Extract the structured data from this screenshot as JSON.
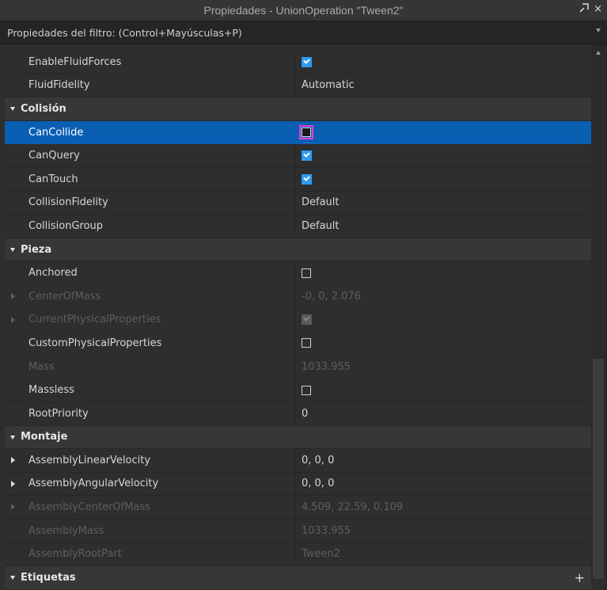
{
  "window": {
    "title": "Propiedades - UnionOperation \"Tween2\"",
    "popout_icon": "popout-icon",
    "close_label": "×"
  },
  "filter": {
    "placeholder": "Propiedades del filtro: (Control+Mayúsculas+P)"
  },
  "rows": [
    {
      "type": "prop",
      "name": "EnableFluidForces",
      "value_type": "checkbox",
      "checked": true
    },
    {
      "type": "prop",
      "name": "FluidFidelity",
      "value_type": "text",
      "value": "Automatic"
    },
    {
      "type": "category",
      "name": "Colisión"
    },
    {
      "type": "prop",
      "name": "CanCollide",
      "value_type": "checkbox",
      "checked": false,
      "selected": true,
      "highlighted": true
    },
    {
      "type": "prop",
      "name": "CanQuery",
      "value_type": "checkbox",
      "checked": true
    },
    {
      "type": "prop",
      "name": "CanTouch",
      "value_type": "checkbox",
      "checked": true
    },
    {
      "type": "prop",
      "name": "CollisionFidelity",
      "value_type": "text",
      "value": "Default"
    },
    {
      "type": "prop",
      "name": "CollisionGroup",
      "value_type": "text",
      "value": "Default"
    },
    {
      "type": "category",
      "name": "Pieza"
    },
    {
      "type": "prop",
      "name": "Anchored",
      "value_type": "checkbox",
      "checked": false
    },
    {
      "type": "prop",
      "name": "CenterOfMass",
      "value_type": "text",
      "value": "-0, 0, 2.076",
      "expandable": true,
      "dim": true
    },
    {
      "type": "prop",
      "name": "CurrentPhysicalProperties",
      "value_type": "checkbox",
      "checked": true,
      "expandable": true,
      "dim": true
    },
    {
      "type": "prop",
      "name": "CustomPhysicalProperties",
      "value_type": "checkbox",
      "checked": false
    },
    {
      "type": "prop",
      "name": "Mass",
      "value_type": "text",
      "value": "1033.955",
      "dim": true
    },
    {
      "type": "prop",
      "name": "Massless",
      "value_type": "checkbox",
      "checked": false
    },
    {
      "type": "prop",
      "name": "RootPriority",
      "value_type": "text",
      "value": "0"
    },
    {
      "type": "category",
      "name": "Montaje"
    },
    {
      "type": "prop",
      "name": "AssemblyLinearVelocity",
      "value_type": "text",
      "value": "0, 0, 0",
      "expandable": true
    },
    {
      "type": "prop",
      "name": "AssemblyAngularVelocity",
      "value_type": "text",
      "value": "0, 0, 0",
      "expandable": true
    },
    {
      "type": "prop",
      "name": "AssemblyCenterOfMass",
      "value_type": "text",
      "value": "4.509, 22.59, 0.109",
      "expandable": true,
      "dim": true
    },
    {
      "type": "prop",
      "name": "AssemblyMass",
      "value_type": "text",
      "value": "1033.955",
      "dim": true
    },
    {
      "type": "prop",
      "name": "AssemblyRootPart",
      "value_type": "text",
      "value": "Tween2",
      "dim": true
    },
    {
      "type": "category",
      "name": "Etiquetas",
      "add_button": "+"
    }
  ]
}
